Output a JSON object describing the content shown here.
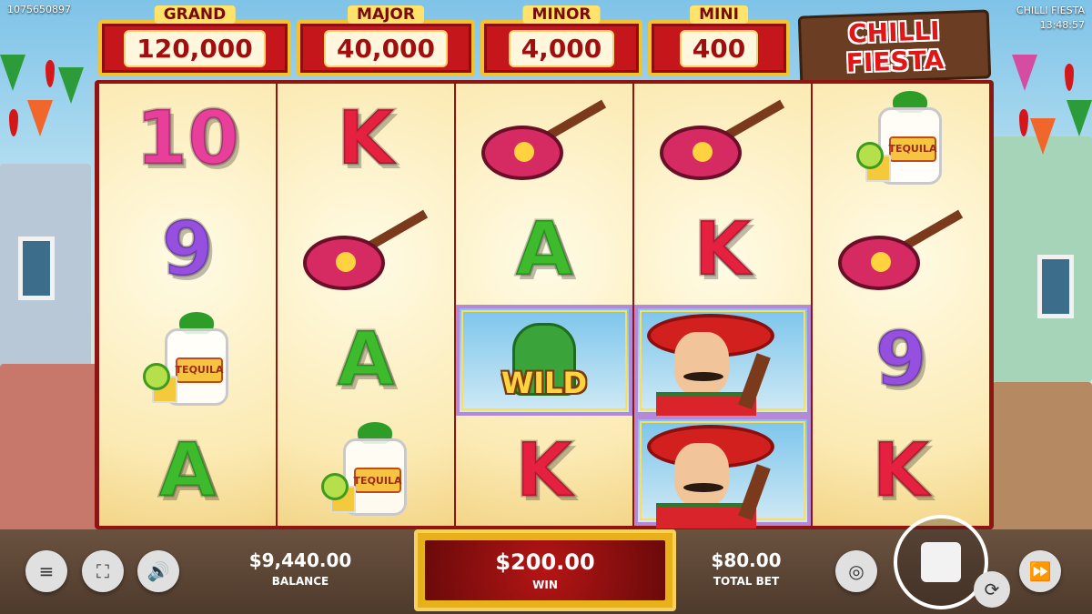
{
  "session_id": "1075650897",
  "game_title": "CHILLI FIESTA",
  "clock": "13:48:57",
  "logo": {
    "line1": "CHILLI",
    "line2": "FIESTA"
  },
  "jackpots": [
    {
      "label": "GRAND",
      "value": "120,000"
    },
    {
      "label": "MAJOR",
      "value": "40,000"
    },
    {
      "label": "MINOR",
      "value": "4,000"
    },
    {
      "label": "MINI",
      "value": "400"
    }
  ],
  "reels": [
    [
      "10",
      "9",
      "tequila",
      "A"
    ],
    [
      "K",
      "guitar",
      "A",
      "tequila"
    ],
    [
      "guitar",
      "A",
      "wild",
      "K"
    ],
    [
      "guitar",
      "K",
      "mariachi",
      "mariachi"
    ],
    [
      "tequila",
      "guitar",
      "9",
      "K"
    ]
  ],
  "symbols": {
    "tequila_label": "TEQUILA",
    "wild_label": "WILD"
  },
  "balance": {
    "value": "$9,440.00",
    "label": "BALANCE"
  },
  "win": {
    "value": "$200.00",
    "label": "WIN"
  },
  "total_bet": {
    "value": "$80.00",
    "label": "TOTAL BET"
  },
  "controls": {
    "menu_icon": "≡",
    "fullscreen_icon": "⛶",
    "sound_icon": "🔊",
    "coins_icon": "◎",
    "autoplay_icon": "⟳",
    "turbo_icon": "⏩"
  },
  "colors": {
    "jackpot_red": "#c5161b",
    "jackpot_gold": "#f3c22c",
    "reel_frame": "#8e1512"
  }
}
